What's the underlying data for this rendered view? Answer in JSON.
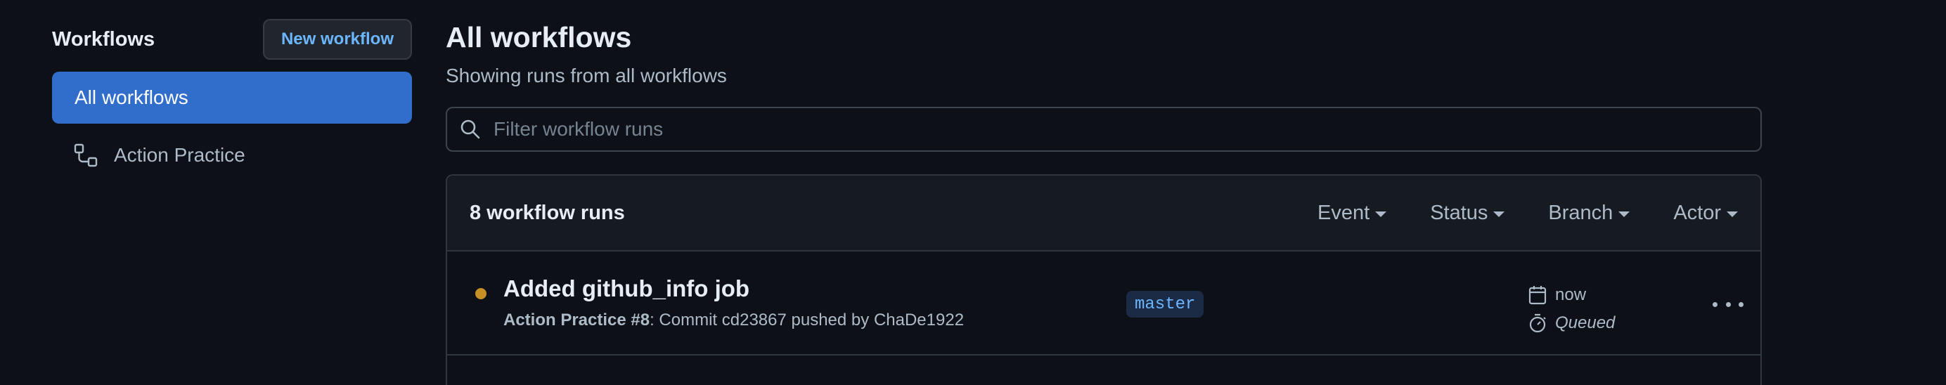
{
  "sidebar": {
    "title": "Workflows",
    "new_workflow_label": "New workflow",
    "items": [
      {
        "label": "All workflows",
        "active": true
      },
      {
        "label": "Action Practice",
        "icon": "workflow-icon",
        "active": false
      }
    ]
  },
  "main": {
    "title": "All workflows",
    "subtitle": "Showing runs from all workflows",
    "filter": {
      "placeholder": "Filter workflow runs",
      "icon": "search-icon"
    },
    "runs": {
      "count_label": "8 workflow runs",
      "filters": [
        "Event",
        "Status",
        "Branch",
        "Actor"
      ],
      "rows": [
        {
          "title": "Added github_info job",
          "workflow": "Action Practice #8",
          "description": ": Commit cd23867 pushed by ChaDe1922",
          "branch": "master",
          "time": "now",
          "duration": "Queued",
          "status": "queued",
          "status_color": "#c69026"
        }
      ]
    }
  },
  "colors": {
    "accent": "#316dca",
    "link": "#6cb6ff",
    "background": "#0d1117"
  }
}
